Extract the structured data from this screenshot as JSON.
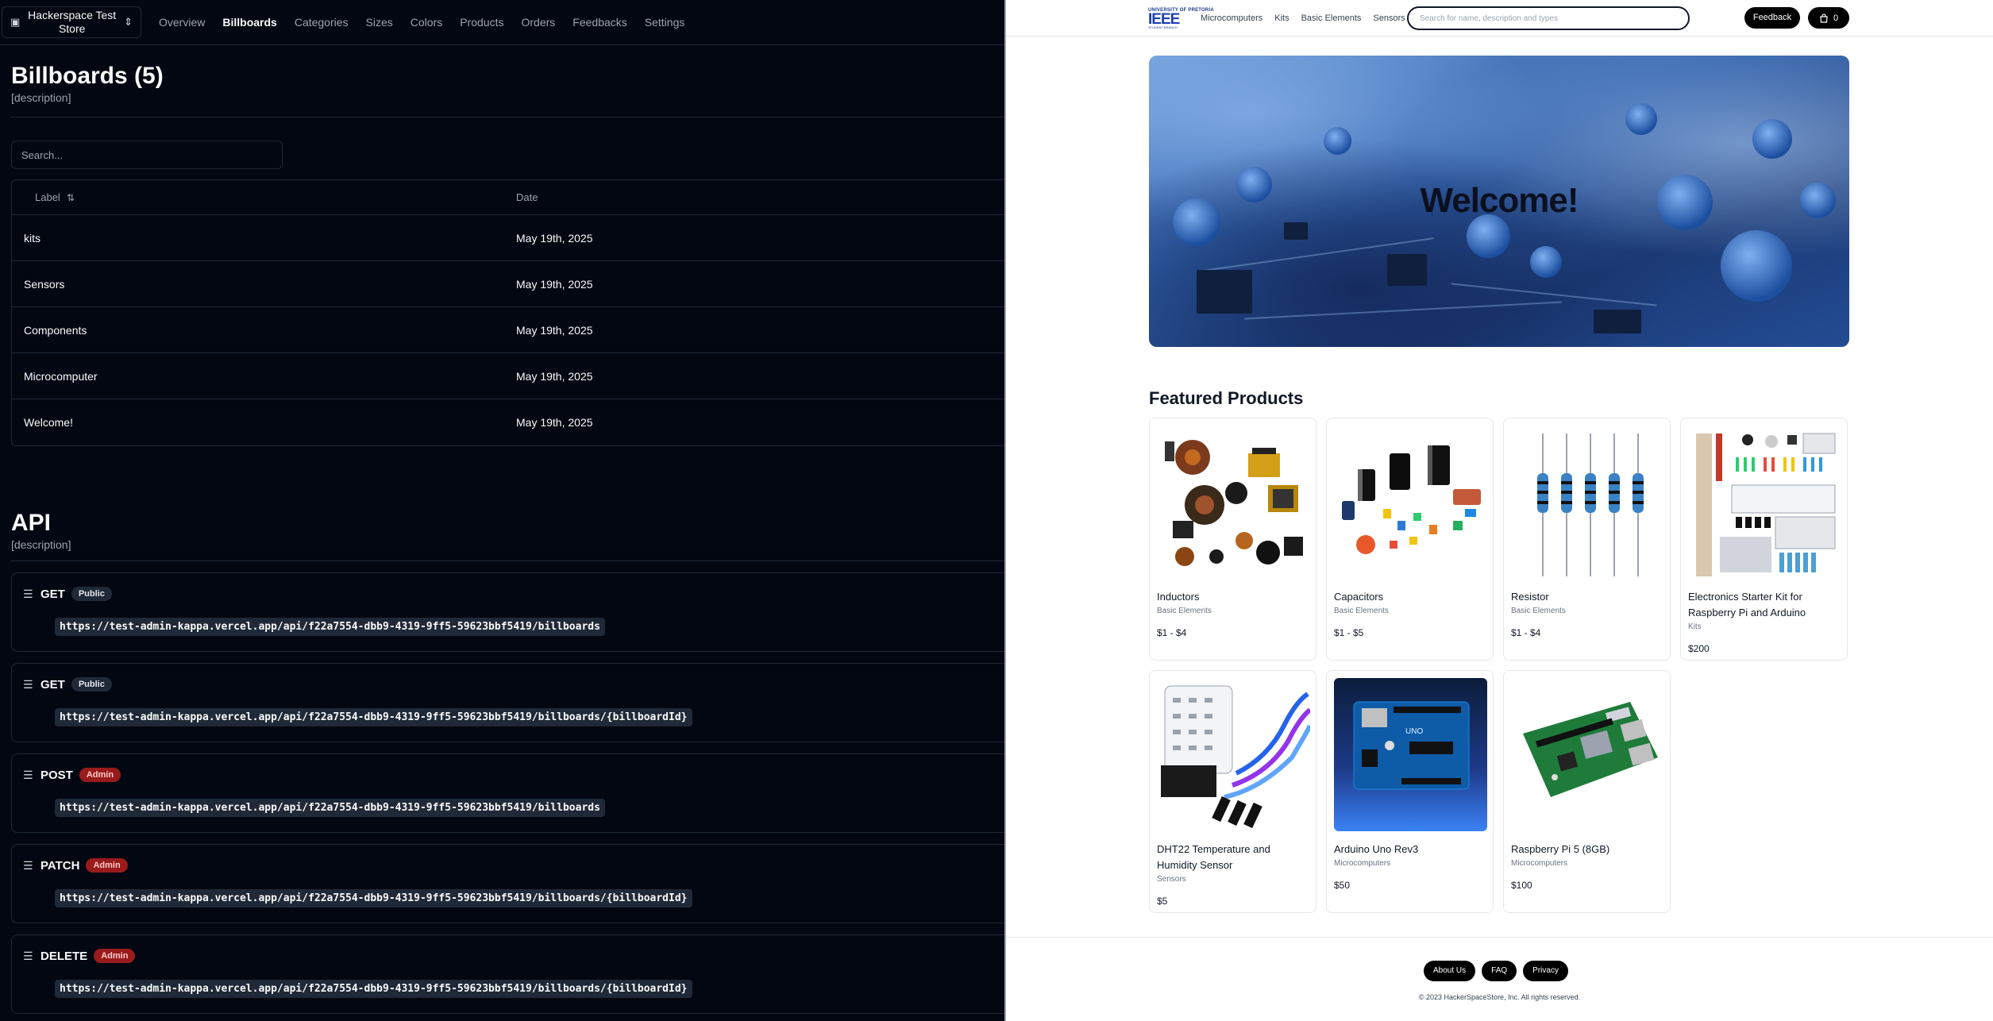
{
  "admin": {
    "store_switcher": "Hackerspace Test Store",
    "nav": [
      "Overview",
      "Billboards",
      "Categories",
      "Sizes",
      "Colors",
      "Products",
      "Orders",
      "Feedbacks",
      "Settings"
    ],
    "active_nav": "Billboards",
    "title": "Billboards (5)",
    "description": "[description]",
    "search_placeholder": "Search...",
    "table": {
      "headers": [
        "Label",
        "Date"
      ],
      "rows": [
        {
          "label": "kits",
          "date": "May 19th, 2025"
        },
        {
          "label": "Sensors",
          "date": "May 19th, 2025"
        },
        {
          "label": "Components",
          "date": "May 19th, 2025"
        },
        {
          "label": "Microcomputer",
          "date": "May 19th, 2025"
        },
        {
          "label": "Welcome!",
          "date": "May 19th, 2025"
        }
      ]
    },
    "api": {
      "title": "API",
      "description": "[description]",
      "endpoints": [
        {
          "method": "GET",
          "badge": "Public",
          "url": "https://test-admin-kappa.vercel.app/api/f22a7554-dbb9-4319-9ff5-59623bbf5419/billboards"
        },
        {
          "method": "GET",
          "badge": "Public",
          "url": "https://test-admin-kappa.vercel.app/api/f22a7554-dbb9-4319-9ff5-59623bbf5419/billboards/{billboardId}"
        },
        {
          "method": "POST",
          "badge": "Admin",
          "url": "https://test-admin-kappa.vercel.app/api/f22a7554-dbb9-4319-9ff5-59623bbf5419/billboards"
        },
        {
          "method": "PATCH",
          "badge": "Admin",
          "url": "https://test-admin-kappa.vercel.app/api/f22a7554-dbb9-4319-9ff5-59623bbf5419/billboards/{billboardId}"
        },
        {
          "method": "DELETE",
          "badge": "Admin",
          "url": "https://test-admin-kappa.vercel.app/api/f22a7554-dbb9-4319-9ff5-59623bbf5419/billboards/{billboardId}"
        }
      ]
    }
  },
  "store": {
    "logo": {
      "top": "UNIVERSITY OF PRETORIA",
      "main": "IEEE",
      "bottom": "STUDENT BRANCH"
    },
    "nav": [
      "Microcomputers",
      "Kits",
      "Basic Elements",
      "Sensors"
    ],
    "search_placeholder": "Search for name, description and types",
    "feedback_label": "Feedback",
    "cart_count": "0",
    "hero_text": "Welcome!",
    "featured_title": "Featured Products",
    "products": [
      {
        "name": "Inductors",
        "category": "Basic Elements",
        "price": "$1 - $4"
      },
      {
        "name": "Capacitors",
        "category": "Basic Elements",
        "price": "$1 - $5"
      },
      {
        "name": "Resistor",
        "category": "Basic Elements",
        "price": "$1 - $4"
      },
      {
        "name": "Electronics Starter Kit for Raspberry Pi and Arduino",
        "category": "Kits",
        "price": "$200"
      },
      {
        "name": "DHT22 Temperature and Humidity Sensor",
        "category": "Sensors",
        "price": "$5"
      },
      {
        "name": "Arduino Uno Rev3",
        "category": "Microcomputers",
        "price": "$50"
      },
      {
        "name": "Raspberry Pi 5 (8GB)",
        "category": "Microcomputers",
        "price": "$100"
      }
    ],
    "footer_links": [
      "About Us",
      "FAQ",
      "Privacy"
    ],
    "copyright": "© 2023 HackerSpaceStore, Inc. All rights reserved."
  },
  "colors": {
    "admin_bg": "#030712",
    "store_bg": "#ffffff",
    "admin_badge": "#991b1b",
    "accent_black": "#000000"
  }
}
